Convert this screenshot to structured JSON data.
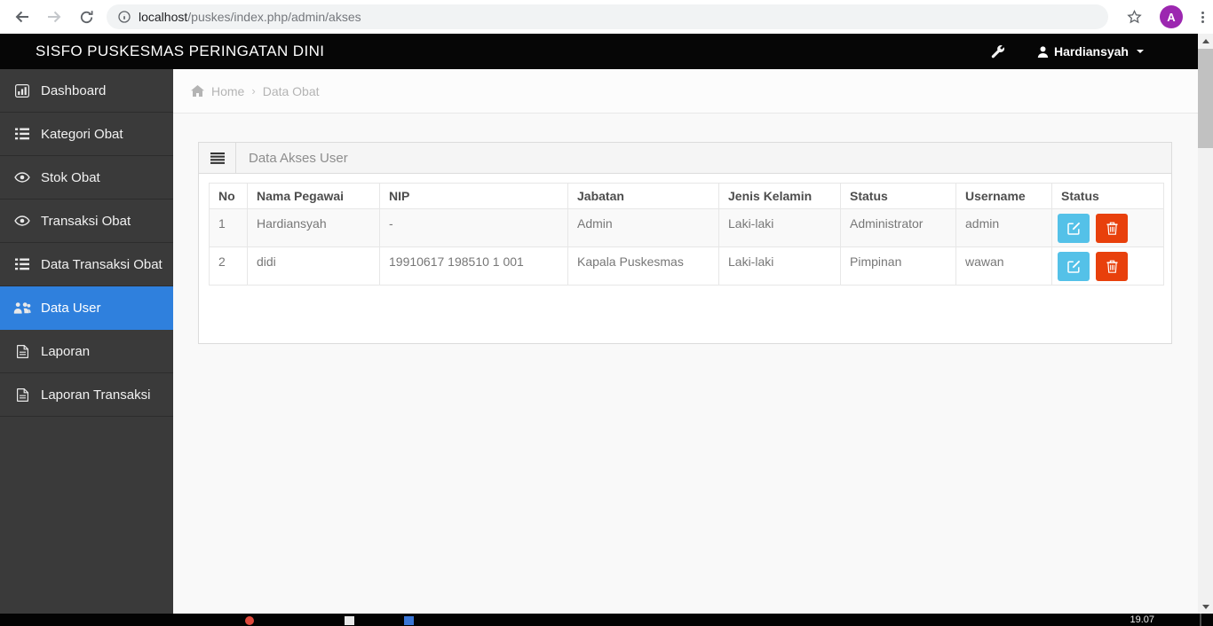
{
  "browser": {
    "url": {
      "host": "localhost",
      "path": "/puskes/index.php/admin/akses"
    },
    "avatar_letter": "A",
    "avatar_color": "#9c27b0"
  },
  "navbar": {
    "title": "SISFO PUSKESMAS PERINGATAN DINI",
    "username": "Hardiansyah"
  },
  "sidebar": {
    "active_color": "#2f80dd",
    "items": [
      {
        "label": "Dashboard",
        "icon": "bar-chart-icon",
        "active": false
      },
      {
        "label": "Kategori Obat",
        "icon": "list-icon",
        "active": false
      },
      {
        "label": "Stok Obat",
        "icon": "eye-icon",
        "active": false
      },
      {
        "label": "Transaksi Obat",
        "icon": "eye-icon",
        "active": false
      },
      {
        "label": "Data Transaksi Obat",
        "icon": "list-icon",
        "active": false
      },
      {
        "label": "Data User",
        "icon": "users-icon",
        "active": true
      },
      {
        "label": "Laporan",
        "icon": "file-icon",
        "active": false
      },
      {
        "label": "Laporan Transaksi",
        "icon": "file-icon",
        "active": false
      }
    ]
  },
  "breadcrumb": {
    "home": "Home",
    "separator": "›",
    "current": "Data Obat"
  },
  "panel": {
    "title": "Data Akses User"
  },
  "table": {
    "headers": [
      "No",
      "Nama Pegawai",
      "NIP",
      "Jabatan",
      "Jenis Kelamin",
      "Status",
      "Username",
      "Status"
    ],
    "rows": [
      {
        "no": "1",
        "nama": "Hardiansyah",
        "nip": "-",
        "jabatan": "Admin",
        "jk": "Laki-laki",
        "status": "Administrator",
        "username": "admin"
      },
      {
        "no": "2",
        "nama": "didi",
        "nip": "19910617 198510 1 001",
        "jabatan": "Kapala Puskesmas",
        "jk": "Laki-laki",
        "status": "Pimpinan",
        "username": "wawan"
      }
    ],
    "action_colors": {
      "edit": "#54c1e8",
      "delete": "#e8400c"
    }
  },
  "taskbar": {
    "time": "19.07"
  }
}
